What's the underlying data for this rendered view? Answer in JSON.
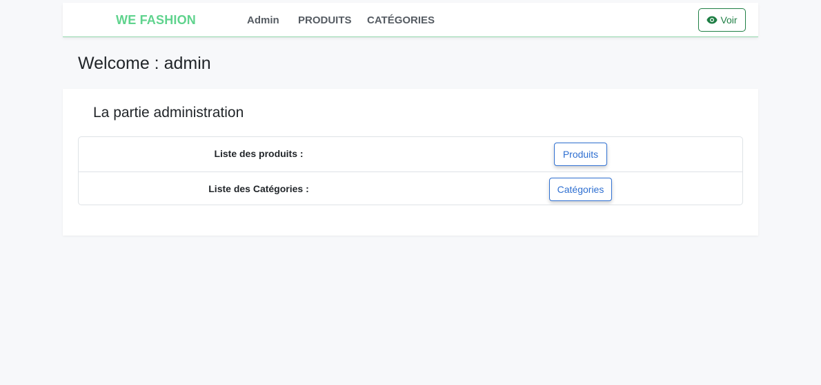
{
  "navbar": {
    "brand": "WE FASHION",
    "links": [
      "Admin",
      "PRODUITS",
      "CATÉGORIES"
    ],
    "voir_label": "Voir",
    "voir_icon": "eye-icon"
  },
  "welcome": "Welcome : admin",
  "admin_panel": {
    "title": "La partie administration",
    "rows": [
      {
        "label": "Liste des produits :",
        "button": "Produits"
      },
      {
        "label": "Liste des Catégories :",
        "button": "Catégories"
      }
    ]
  },
  "colors": {
    "brand": "#5fd38d",
    "voir_button": "#1e7e44",
    "primary_outline": "#2e6fd1",
    "background": "#f7f8fa"
  }
}
